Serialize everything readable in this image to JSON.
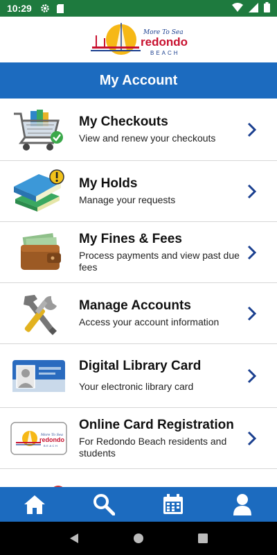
{
  "status_bar": {
    "time": "10:29"
  },
  "logo": {
    "tagline": "More To Sea",
    "name": "redondo",
    "sub": "BEACH"
  },
  "header": {
    "title": "My Account"
  },
  "menu": [
    {
      "title": "My Checkouts",
      "subtitle": "View and renew your checkouts",
      "icon": "shopping-cart-icon"
    },
    {
      "title": "My Holds",
      "subtitle": "Manage your requests",
      "icon": "books-alert-icon"
    },
    {
      "title": "My Fines & Fees",
      "subtitle": "Process payments and view past due fees",
      "icon": "wallet-icon"
    },
    {
      "title": "Manage Accounts",
      "subtitle": "Access your account information",
      "icon": "tools-icon"
    },
    {
      "title": "Digital Library Card",
      "subtitle": "Your electronic library card",
      "icon": "library-card-icon"
    },
    {
      "title": "Online Card Registration",
      "subtitle": "For Redondo Beach residents and students",
      "icon": "redondo-logo-card-icon"
    }
  ],
  "colors": {
    "primary": "#1c6bbf",
    "status_bar": "#1e7a3e",
    "chevron": "#1a3f8f",
    "brand_red": "#c8102e",
    "brand_yellow": "#f6b816"
  }
}
